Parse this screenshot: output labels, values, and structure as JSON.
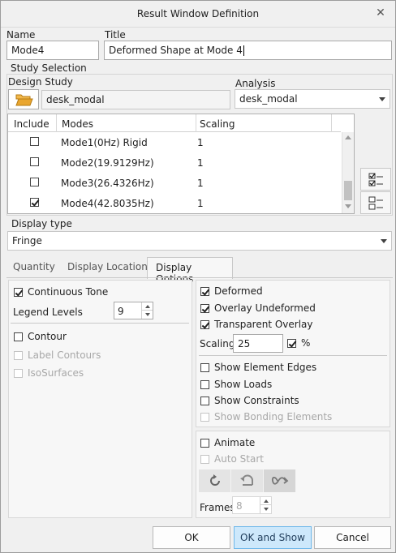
{
  "window": {
    "title": "Result Window Definition",
    "close_glyph": "✕"
  },
  "fields": {
    "name_label": "Name",
    "name_value": "Mode4",
    "title_label": "Title",
    "title_value": "Deformed Shape at Mode 4"
  },
  "study": {
    "section_label": "Study Selection",
    "design_study_label": "Design Study",
    "design_study_value": "desk_modal",
    "analysis_label": "Analysis",
    "analysis_value": "desk_modal"
  },
  "modes_table": {
    "columns": [
      "Include",
      "Modes",
      "Scaling"
    ],
    "rows": [
      {
        "include": false,
        "mode": "Mode1(0Hz) Rigid",
        "scaling": "1"
      },
      {
        "include": false,
        "mode": "Mode2(19.9129Hz)",
        "scaling": "1"
      },
      {
        "include": false,
        "mode": "Mode3(26.4326Hz)",
        "scaling": "1"
      },
      {
        "include": true,
        "mode": "Mode4(42.8035Hz)",
        "scaling": "1"
      }
    ]
  },
  "display_type": {
    "label": "Display type",
    "value": "Fringe"
  },
  "tabs": [
    {
      "label": "Quantity",
      "active": false
    },
    {
      "label": "Display Location",
      "active": false
    },
    {
      "label": "Display Options",
      "active": true
    }
  ],
  "left_options": {
    "continuous_tone": {
      "label": "Continuous Tone",
      "checked": true
    },
    "legend_levels_label": "Legend Levels",
    "legend_levels_value": "9",
    "contour": {
      "label": "Contour",
      "checked": false
    },
    "label_contours": {
      "label": "Label Contours",
      "checked": false,
      "disabled": true
    },
    "isosurfaces": {
      "label": "IsoSurfaces",
      "checked": false,
      "disabled": true
    }
  },
  "right_options": {
    "deformed": {
      "label": "Deformed",
      "checked": true
    },
    "overlay_undeformed": {
      "label": "Overlay Undeformed",
      "checked": true
    },
    "transparent_overlay": {
      "label": "Transparent Overlay",
      "checked": true
    },
    "scaling_label": "Scaling",
    "scaling_value": "25",
    "percent": {
      "label": "%",
      "checked": true
    },
    "show_element_edges": {
      "label": "Show Element Edges",
      "checked": false
    },
    "show_loads": {
      "label": "Show Loads",
      "checked": false
    },
    "show_constraints": {
      "label": "Show Constraints",
      "checked": false
    },
    "show_bonding_elements": {
      "label": "Show Bonding Elements",
      "checked": false,
      "disabled": true
    }
  },
  "animate": {
    "animate": {
      "label": "Animate",
      "checked": false
    },
    "auto_start": {
      "label": "Auto Start",
      "checked": false,
      "disabled": true
    },
    "frames_label": "Frames",
    "frames_value": "8"
  },
  "buttons": {
    "ok": "OK",
    "ok_and_show": "OK and Show",
    "cancel": "Cancel"
  },
  "colors": {
    "primary_button_bg": "#cde8fb",
    "primary_button_border": "#6fb8ea",
    "folder_icon": "#e9a62f"
  }
}
